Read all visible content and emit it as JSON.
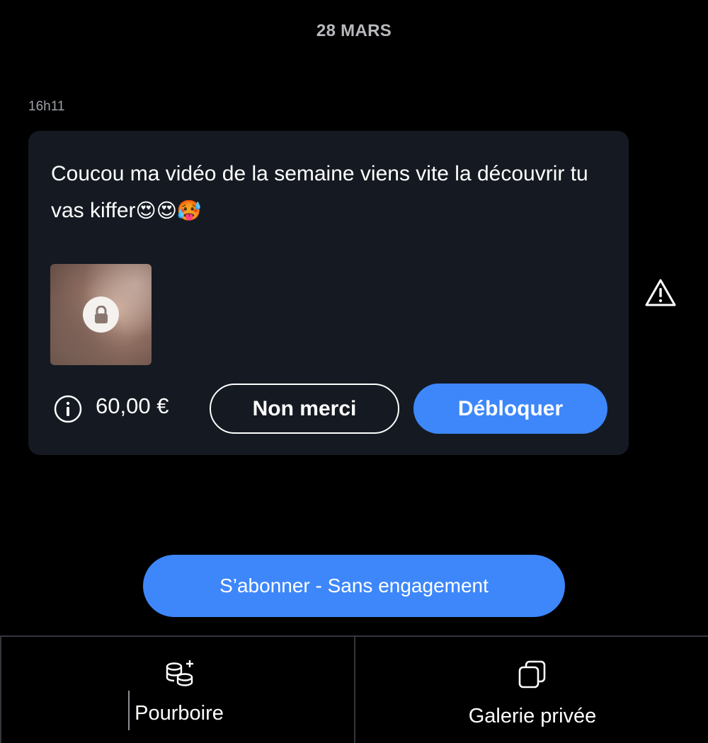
{
  "date_separator": "28 MARS",
  "message": {
    "time": "16h11",
    "text": "Coucou ma vidéo de la semaine viens vite la découvrir tu vas kiffer",
    "emojis": [
      "😍",
      "😍",
      "🥵"
    ],
    "media": {
      "locked": true,
      "icon": "lock-icon"
    },
    "price": "60,00 €",
    "decline_label": "Non merci",
    "unlock_label": "Débloquer"
  },
  "subscribe_label": "S’abonner - Sans engagement",
  "bottom_bar": {
    "tip": {
      "label": "Pourboire",
      "icon": "coins-plus-icon"
    },
    "gallery": {
      "label": "Galerie privée",
      "icon": "copy-stack-icon"
    }
  },
  "colors": {
    "background": "#000000",
    "bubble": "#151a22",
    "accent": "#3d87fb",
    "muted_text": "#9ea2a8"
  }
}
